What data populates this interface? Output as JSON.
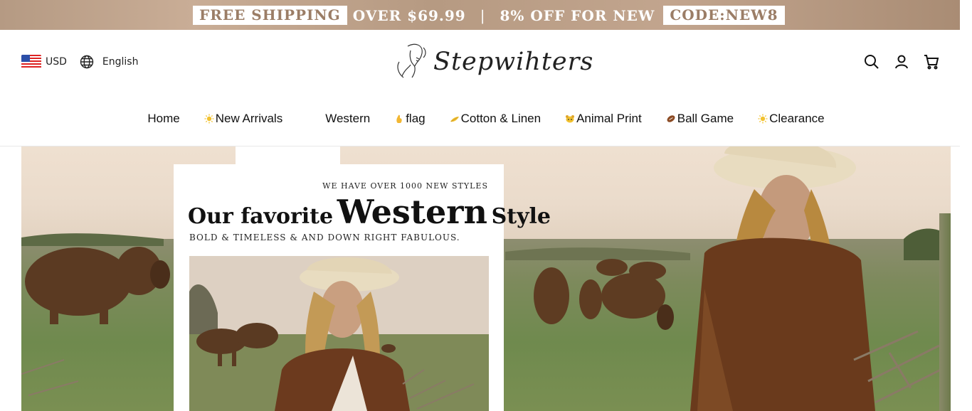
{
  "promo": {
    "shipping_box": "FREE SHIPPING",
    "shipping_text": "OVER $69.99",
    "separator": "|",
    "discount_text": "8% OFF FOR NEW",
    "code_box": "CODE:NEW8"
  },
  "header": {
    "currency": "USD",
    "language": "English",
    "logo_text": "Stepwihters"
  },
  "nav": {
    "items": [
      {
        "label": "Home"
      },
      {
        "label": "New Arrivals",
        "icon": "sun-icon"
      },
      {
        "label": "Western"
      },
      {
        "label": "flag",
        "icon": "hand-icon"
      },
      {
        "label": "Cotton & Linen",
        "icon": "leaf-icon"
      },
      {
        "label": "Animal Print",
        "icon": "animal-icon"
      },
      {
        "label": "Ball Game",
        "icon": "football-icon"
      },
      {
        "label": "Clearance",
        "icon": "sun-icon"
      }
    ]
  },
  "hero": {
    "eyebrow": "WE HAVE OVER 1000 NEW STYLES",
    "headline_part1": "Our favorite",
    "headline_part2": "Western",
    "headline_part3": "Style",
    "tagline": "BOLD & TIMELESS & AND DOWN RIGHT FABULOUS."
  },
  "colors": {
    "promo_bg": "#b89d86",
    "promo_box_text": "#9b7d66",
    "accent_gold": "#f2c230"
  }
}
